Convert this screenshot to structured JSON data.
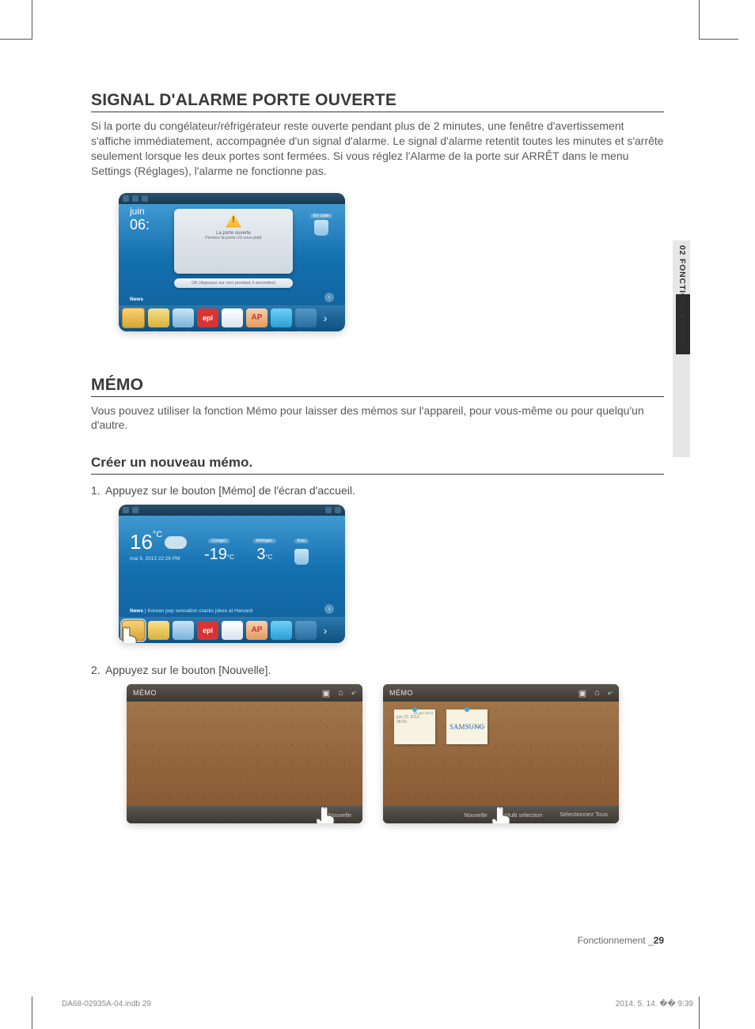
{
  "section1": {
    "title": "SIGNAL D'ALARME PORTE OUVERTE",
    "body": "Si la porte du congélateur/réfrigérateur reste ouverte pendant plus de 2 minutes, une fenêtre d'avertissement s'affiche immédiatement, accompagnée d'un signal d'alarme. Le signal d'alarme retentit toutes les minutes et s'arrête seulement lorsque les deux portes sont fermées. Si vous réglez l'Alarme de la porte sur ARRÊT dans le menu Settings (Réglages), l'alarme ne fonctionne pas."
  },
  "alarm_popup": {
    "month": "juin",
    "time": "06:",
    "line1": "La porte ouverte",
    "line2": "Fermez la porte s'il vous plaît",
    "ok": "OK (Appuyez sur ceci pendant 3 secondes)",
    "ice_label": "En cube",
    "news": "News"
  },
  "dock": {
    "apps": [
      "Memo",
      "Photos",
      "GroceryMgr",
      "Epicurious",
      "Calendar",
      "AP News",
      "Twitter",
      "Settings"
    ],
    "epi": "epi",
    "ap": "AP"
  },
  "section2": {
    "title": "MÉMO",
    "body": "Vous pouvez utiliser la fonction Mémo pour laisser des mémos sur l'appareil, pour vous-même ou pour quelqu'un d'autre."
  },
  "sub1": {
    "title": "Créer un nouveau mémo.",
    "step1_num": "1.",
    "step1": "Appuyez sur le bouton [Mémo] de l'écran d'accueil.",
    "step2_num": "2.",
    "step2": "Appuyez sur le bouton [Nouvelle]."
  },
  "home": {
    "temp": "16",
    "unit": "°C",
    "date": "mai 9, 2013 22:26 PM",
    "freezer_label": "Congel.",
    "freezer_val": "-19",
    "fridge_label": "Réfrigér.",
    "fridge_val": "3",
    "water_label": "Eau",
    "news_tag": "News",
    "news_text": "Korean pop sensation cracks jokes at Harvard"
  },
  "memo_app": {
    "title": "MÉMO",
    "new": "Nouvelle",
    "multi": "Multi sélection",
    "select_all": "Sélectionnez Tous",
    "note1_date": "23 juin 2013",
    "note1_text": "juin 22, 2012, 08:00...",
    "note2_date": "23 juin 2013",
    "note2_text": "SAMSUNG"
  },
  "side_tab": "02  FONCTIONNEMENT",
  "footer": {
    "label": "Fonctionnement _",
    "page": "29"
  },
  "print": {
    "left": "DA68-02935A-04.indb   29",
    "right": "2014. 5. 14.   �� 9:39"
  }
}
